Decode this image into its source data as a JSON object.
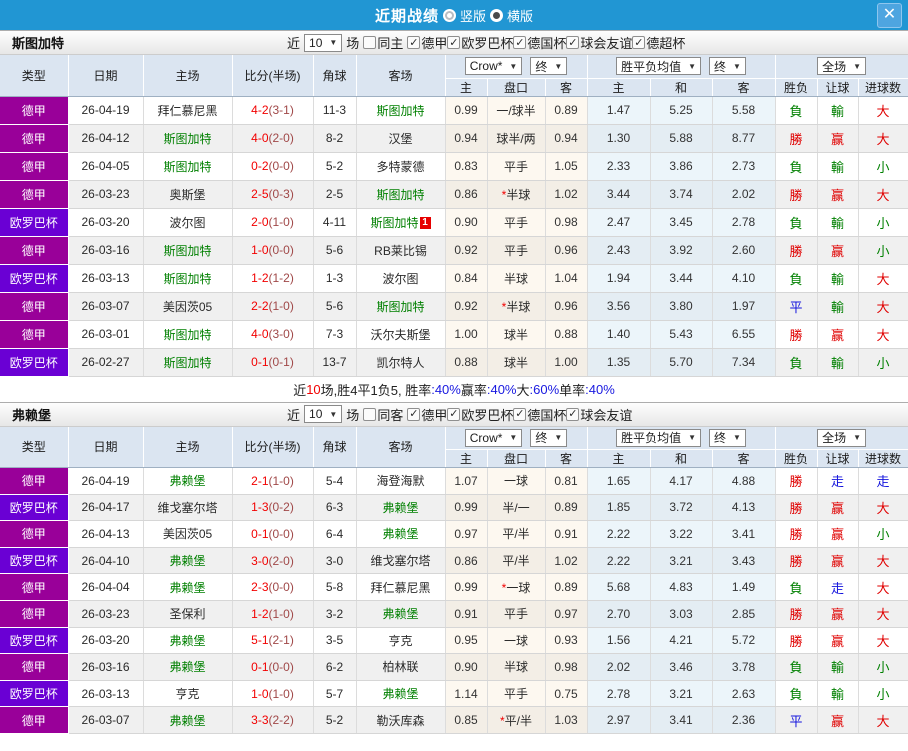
{
  "titlebar": {
    "title": "近期战绩",
    "radios": [
      {
        "label": "竖版",
        "checked": false
      },
      {
        "label": "横版",
        "checked": true
      }
    ],
    "close_icon": "✕"
  },
  "table_header": {
    "type": "类型",
    "date": "日期",
    "home": "主场",
    "score_half": "比分(半场)",
    "corner": "角球",
    "away": "客场",
    "crow_select": "Crow*",
    "final_select": "终",
    "avg_select": "胜平负均值",
    "full_select": "全场",
    "odds_home": "主",
    "odds_handicap": "盘口",
    "odds_away": "客",
    "avg_home": "主",
    "avg_draw": "和",
    "avg_away": "客",
    "result": "胜负",
    "handicap_result": "让球",
    "goals": "进球数"
  },
  "colors": {
    "league": {
      "德甲": "#990099",
      "欧罗巴杯": "#6a00d4"
    },
    "result": {
      "勝": "#e00000",
      "赢": "#e00000",
      "大": "#e00000",
      "平": "#1515dd",
      "走": "#1515dd",
      "負": "#008000",
      "輸": "#008000",
      "小": "#008000"
    }
  },
  "sections": [
    {
      "team": "斯图加特",
      "filter": {
        "prefix": "近",
        "count": "10",
        "suffix": "场",
        "venue": {
          "label": "同主",
          "checked": false
        },
        "leagues": [
          {
            "label": "德甲",
            "checked": true
          },
          {
            "label": "欧罗巴杯",
            "checked": true
          },
          {
            "label": "德国杯",
            "checked": true
          },
          {
            "label": "球会友谊",
            "checked": true
          },
          {
            "label": "德超杯",
            "checked": true
          }
        ]
      },
      "rows": [
        {
          "league": "德甲",
          "date": "26-04-19",
          "home": "拜仁慕尼黑",
          "home_focus": false,
          "score": "4-2",
          "half": "(3-1)",
          "corner": "11-3",
          "away": "斯图加特",
          "away_focus": true,
          "away_badge": "",
          "crow_home": "0.99",
          "handicap": "一/球半",
          "handicap_star": false,
          "crow_away": "0.89",
          "avg_home": "1.47",
          "avg_draw": "5.25",
          "avg_away": "5.58",
          "result": "負",
          "handicap_result": "輸",
          "goals": "大"
        },
        {
          "league": "德甲",
          "date": "26-04-12",
          "home": "斯图加特",
          "home_focus": true,
          "score": "4-0",
          "half": "(2-0)",
          "corner": "8-2",
          "away": "汉堡",
          "away_focus": false,
          "away_badge": "",
          "crow_home": "0.94",
          "handicap": "球半/两",
          "handicap_star": false,
          "crow_away": "0.94",
          "avg_home": "1.30",
          "avg_draw": "5.88",
          "avg_away": "8.77",
          "result": "勝",
          "handicap_result": "赢",
          "goals": "大"
        },
        {
          "league": "德甲",
          "date": "26-04-05",
          "home": "斯图加特",
          "home_focus": true,
          "score": "0-2",
          "half": "(0-0)",
          "corner": "5-2",
          "away": "多特蒙德",
          "away_focus": false,
          "away_badge": "",
          "crow_home": "0.83",
          "handicap": "平手",
          "handicap_star": false,
          "crow_away": "1.05",
          "avg_home": "2.33",
          "avg_draw": "3.86",
          "avg_away": "2.73",
          "result": "負",
          "handicap_result": "輸",
          "goals": "小"
        },
        {
          "league": "德甲",
          "date": "26-03-23",
          "home": "奥斯堡",
          "home_focus": false,
          "score": "2-5",
          "half": "(0-3)",
          "corner": "2-5",
          "away": "斯图加特",
          "away_focus": true,
          "away_badge": "",
          "crow_home": "0.86",
          "handicap": "半球",
          "handicap_star": true,
          "crow_away": "1.02",
          "avg_home": "3.44",
          "avg_draw": "3.74",
          "avg_away": "2.02",
          "result": "勝",
          "handicap_result": "赢",
          "goals": "大"
        },
        {
          "league": "欧罗巴杯",
          "date": "26-03-20",
          "home": "波尔图",
          "home_focus": false,
          "score": "2-0",
          "half": "(1-0)",
          "corner": "4-11",
          "away": "斯图加特",
          "away_focus": true,
          "away_badge": "1",
          "crow_home": "0.90",
          "handicap": "平手",
          "handicap_star": false,
          "crow_away": "0.98",
          "avg_home": "2.47",
          "avg_draw": "3.45",
          "avg_away": "2.78",
          "result": "負",
          "handicap_result": "輸",
          "goals": "小"
        },
        {
          "league": "德甲",
          "date": "26-03-16",
          "home": "斯图加特",
          "home_focus": true,
          "score": "1-0",
          "half": "(0-0)",
          "corner": "5-6",
          "away": "RB莱比锡",
          "away_focus": false,
          "away_badge": "",
          "crow_home": "0.92",
          "handicap": "平手",
          "handicap_star": false,
          "crow_away": "0.96",
          "avg_home": "2.43",
          "avg_draw": "3.92",
          "avg_away": "2.60",
          "result": "勝",
          "handicap_result": "赢",
          "goals": "小"
        },
        {
          "league": "欧罗巴杯",
          "date": "26-03-13",
          "home": "斯图加特",
          "home_focus": true,
          "score": "1-2",
          "half": "(1-2)",
          "corner": "1-3",
          "away": "波尔图",
          "away_focus": false,
          "away_badge": "",
          "crow_home": "0.84",
          "handicap": "半球",
          "handicap_star": false,
          "crow_away": "1.04",
          "avg_home": "1.94",
          "avg_draw": "3.44",
          "avg_away": "4.10",
          "result": "負",
          "handicap_result": "輸",
          "goals": "大"
        },
        {
          "league": "德甲",
          "date": "26-03-07",
          "home": "美因茨05",
          "home_focus": false,
          "score": "2-2",
          "half": "(1-0)",
          "corner": "5-6",
          "away": "斯图加特",
          "away_focus": true,
          "away_badge": "",
          "crow_home": "0.92",
          "handicap": "半球",
          "handicap_star": true,
          "crow_away": "0.96",
          "avg_home": "3.56",
          "avg_draw": "3.80",
          "avg_away": "1.97",
          "result": "平",
          "handicap_result": "輸",
          "goals": "大"
        },
        {
          "league": "德甲",
          "date": "26-03-01",
          "home": "斯图加特",
          "home_focus": true,
          "score": "4-0",
          "half": "(3-0)",
          "corner": "7-3",
          "away": "沃尔夫斯堡",
          "away_focus": false,
          "away_badge": "",
          "crow_home": "1.00",
          "handicap": "球半",
          "handicap_star": false,
          "crow_away": "0.88",
          "avg_home": "1.40",
          "avg_draw": "5.43",
          "avg_away": "6.55",
          "result": "勝",
          "handicap_result": "赢",
          "goals": "大"
        },
        {
          "league": "欧罗巴杯",
          "date": "26-02-27",
          "home": "斯图加特",
          "home_focus": true,
          "score": "0-1",
          "half": "(0-1)",
          "corner": "13-7",
          "away": "凯尔特人",
          "away_focus": false,
          "away_badge": "",
          "crow_home": "0.88",
          "handicap": "球半",
          "handicap_star": false,
          "crow_away": "1.00",
          "avg_home": "1.35",
          "avg_draw": "5.70",
          "avg_away": "7.34",
          "result": "負",
          "handicap_result": "輸",
          "goals": "小"
        }
      ],
      "summary": [
        {
          "text": "近",
          "color": "k"
        },
        {
          "text": "10",
          "color": "r"
        },
        {
          "text": "场,胜4平1负5, 胜率",
          "color": "k"
        },
        {
          "text": ":40%",
          "color": "b"
        },
        {
          "text": " 赢率",
          "color": "k"
        },
        {
          "text": ":40%",
          "color": "b"
        },
        {
          "text": " 大",
          "color": "k"
        },
        {
          "text": ":60%",
          "color": "b"
        },
        {
          "text": " 单率",
          "color": "k"
        },
        {
          "text": ":40%",
          "color": "b"
        }
      ]
    },
    {
      "team": "弗赖堡",
      "filter": {
        "prefix": "近",
        "count": "10",
        "suffix": "场",
        "venue": {
          "label": "同客",
          "checked": false
        },
        "leagues": [
          {
            "label": "德甲",
            "checked": true
          },
          {
            "label": "欧罗巴杯",
            "checked": true
          },
          {
            "label": "德国杯",
            "checked": true
          },
          {
            "label": "球会友谊",
            "checked": true
          }
        ]
      },
      "rows": [
        {
          "league": "德甲",
          "date": "26-04-19",
          "home": "弗赖堡",
          "home_focus": true,
          "score": "2-1",
          "half": "(1-0)",
          "corner": "5-4",
          "away": "海登海默",
          "away_focus": false,
          "away_badge": "",
          "crow_home": "1.07",
          "handicap": "一球",
          "handicap_star": false,
          "crow_away": "0.81",
          "avg_home": "1.65",
          "avg_draw": "4.17",
          "avg_away": "4.88",
          "result": "勝",
          "handicap_result": "走",
          "goals": "走"
        },
        {
          "league": "欧罗巴杯",
          "date": "26-04-17",
          "home": "维戈塞尔塔",
          "home_focus": false,
          "score": "1-3",
          "half": "(0-2)",
          "corner": "6-3",
          "away": "弗赖堡",
          "away_focus": true,
          "away_badge": "",
          "crow_home": "0.99",
          "handicap": "半/一",
          "handicap_star": false,
          "crow_away": "0.89",
          "avg_home": "1.85",
          "avg_draw": "3.72",
          "avg_away": "4.13",
          "result": "勝",
          "handicap_result": "赢",
          "goals": "大"
        },
        {
          "league": "德甲",
          "date": "26-04-13",
          "home": "美因茨05",
          "home_focus": false,
          "score": "0-1",
          "half": "(0-0)",
          "corner": "6-4",
          "away": "弗赖堡",
          "away_focus": true,
          "away_badge": "",
          "crow_home": "0.97",
          "handicap": "平/半",
          "handicap_star": false,
          "crow_away": "0.91",
          "avg_home": "2.22",
          "avg_draw": "3.22",
          "avg_away": "3.41",
          "result": "勝",
          "handicap_result": "赢",
          "goals": "小"
        },
        {
          "league": "欧罗巴杯",
          "date": "26-04-10",
          "home": "弗赖堡",
          "home_focus": true,
          "score": "3-0",
          "half": "(2-0)",
          "corner": "3-0",
          "away": "维戈塞尔塔",
          "away_focus": false,
          "away_badge": "",
          "crow_home": "0.86",
          "handicap": "平/半",
          "handicap_star": false,
          "crow_away": "1.02",
          "avg_home": "2.22",
          "avg_draw": "3.21",
          "avg_away": "3.43",
          "result": "勝",
          "handicap_result": "赢",
          "goals": "大"
        },
        {
          "league": "德甲",
          "date": "26-04-04",
          "home": "弗赖堡",
          "home_focus": true,
          "score": "2-3",
          "half": "(0-0)",
          "corner": "5-8",
          "away": "拜仁慕尼黑",
          "away_focus": false,
          "away_badge": "",
          "crow_home": "0.99",
          "handicap": "一球",
          "handicap_star": true,
          "crow_away": "0.89",
          "avg_home": "5.68",
          "avg_draw": "4.83",
          "avg_away": "1.49",
          "result": "負",
          "handicap_result": "走",
          "goals": "大"
        },
        {
          "league": "德甲",
          "date": "26-03-23",
          "home": "圣保利",
          "home_focus": false,
          "score": "1-2",
          "half": "(1-0)",
          "corner": "3-2",
          "away": "弗赖堡",
          "away_focus": true,
          "away_badge": "",
          "crow_home": "0.91",
          "handicap": "平手",
          "handicap_star": false,
          "crow_away": "0.97",
          "avg_home": "2.70",
          "avg_draw": "3.03",
          "avg_away": "2.85",
          "result": "勝",
          "handicap_result": "赢",
          "goals": "大"
        },
        {
          "league": "欧罗巴杯",
          "date": "26-03-20",
          "home": "弗赖堡",
          "home_focus": true,
          "score": "5-1",
          "half": "(2-1)",
          "corner": "3-5",
          "away": "亨克",
          "away_focus": false,
          "away_badge": "",
          "crow_home": "0.95",
          "handicap": "一球",
          "handicap_star": false,
          "crow_away": "0.93",
          "avg_home": "1.56",
          "avg_draw": "4.21",
          "avg_away": "5.72",
          "result": "勝",
          "handicap_result": "赢",
          "goals": "大"
        },
        {
          "league": "德甲",
          "date": "26-03-16",
          "home": "弗赖堡",
          "home_focus": true,
          "score": "0-1",
          "half": "(0-0)",
          "corner": "6-2",
          "away": "柏林联",
          "away_focus": false,
          "away_badge": "",
          "crow_home": "0.90",
          "handicap": "半球",
          "handicap_star": false,
          "crow_away": "0.98",
          "avg_home": "2.02",
          "avg_draw": "3.46",
          "avg_away": "3.78",
          "result": "負",
          "handicap_result": "輸",
          "goals": "小"
        },
        {
          "league": "欧罗巴杯",
          "date": "26-03-13",
          "home": "亨克",
          "home_focus": false,
          "score": "1-0",
          "half": "(1-0)",
          "corner": "5-7",
          "away": "弗赖堡",
          "away_focus": true,
          "away_badge": "",
          "crow_home": "1.14",
          "handicap": "平手",
          "handicap_star": false,
          "crow_away": "0.75",
          "avg_home": "2.78",
          "avg_draw": "3.21",
          "avg_away": "2.63",
          "result": "負",
          "handicap_result": "輸",
          "goals": "小"
        },
        {
          "league": "德甲",
          "date": "26-03-07",
          "home": "弗赖堡",
          "home_focus": true,
          "score": "3-3",
          "half": "(2-2)",
          "corner": "5-2",
          "away": "勒沃库森",
          "away_focus": false,
          "away_badge": "",
          "crow_home": "0.85",
          "handicap": "平/半",
          "handicap_star": true,
          "crow_away": "1.03",
          "avg_home": "2.97",
          "avg_draw": "3.41",
          "avg_away": "2.36",
          "result": "平",
          "handicap_result": "赢",
          "goals": "大"
        }
      ],
      "summary": null
    }
  ]
}
